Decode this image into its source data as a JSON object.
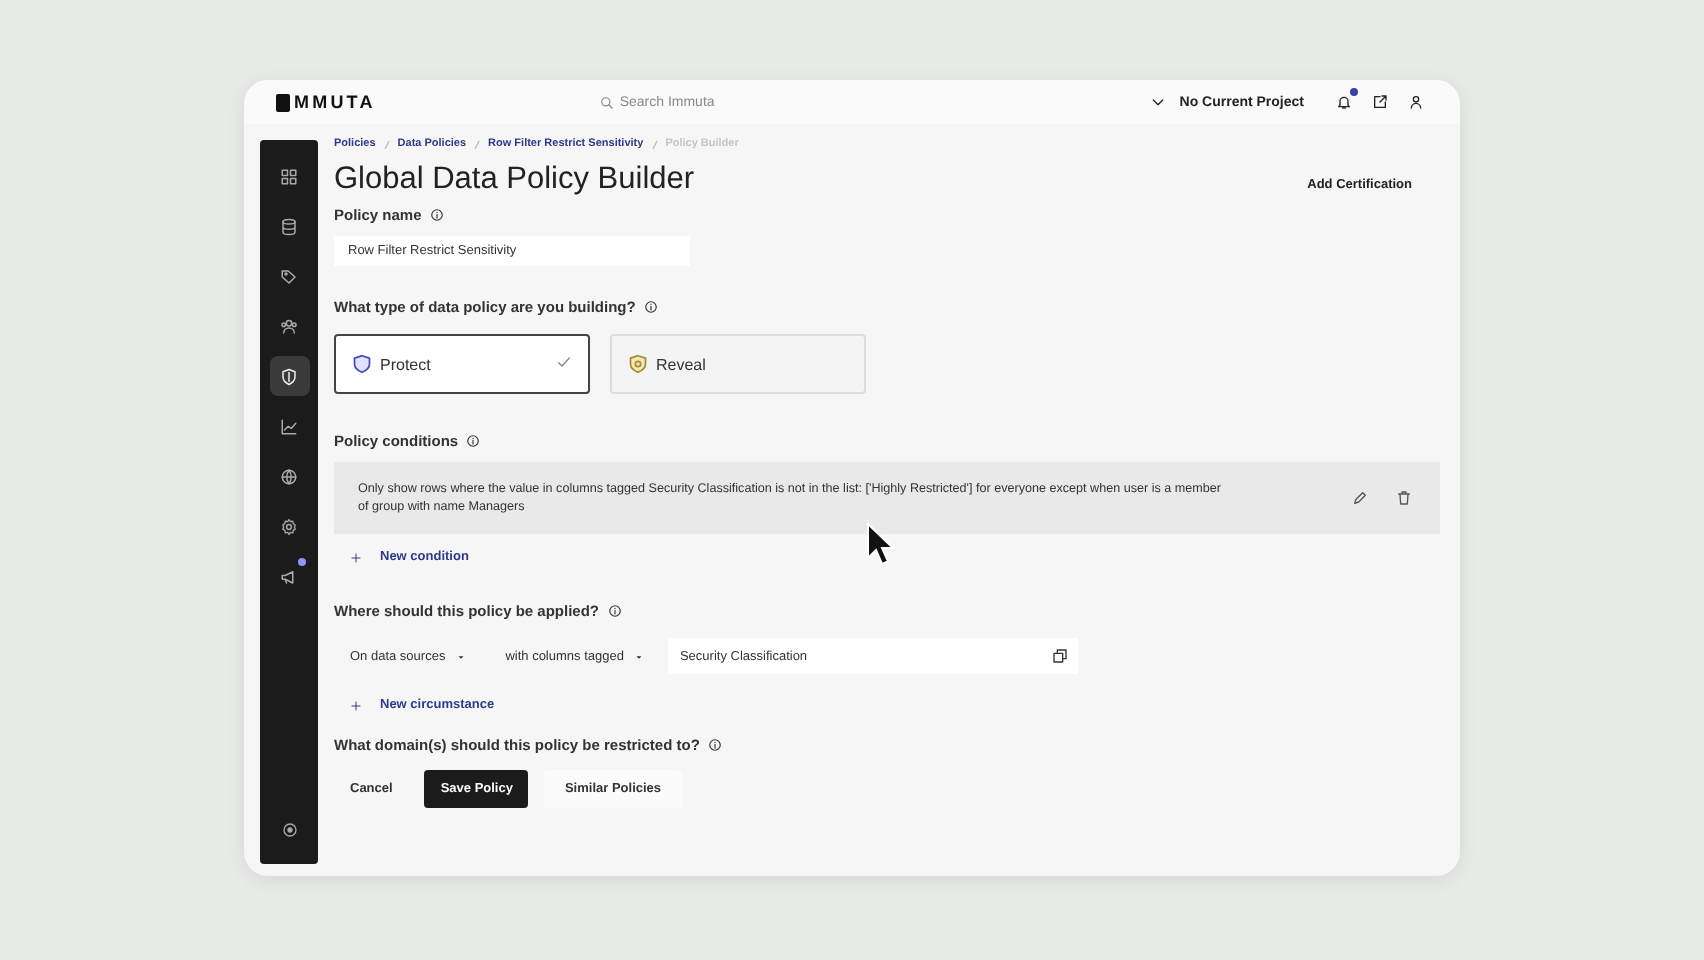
{
  "header": {
    "logo": "MMUTA",
    "search": {
      "placeholder": "Search Immuta"
    },
    "project": "No Current Project",
    "notifications_unread": true
  },
  "sidebar": {
    "items": [
      {
        "kind": "grid",
        "selected": false,
        "badge": false
      },
      {
        "kind": "database",
        "selected": false,
        "badge": false
      },
      {
        "kind": "tags",
        "selected": false,
        "badge": false
      },
      {
        "kind": "users",
        "selected": false,
        "badge": false
      },
      {
        "kind": "shield",
        "selected": true,
        "badge": false
      },
      {
        "kind": "chart",
        "selected": false,
        "badge": false
      },
      {
        "kind": "globe",
        "selected": false,
        "badge": false
      },
      {
        "kind": "gear",
        "selected": false,
        "badge": false
      },
      {
        "kind": "megaphone",
        "selected": false,
        "badge": true
      }
    ]
  },
  "breadcrumbs": [
    {
      "label": "Policies",
      "current": false
    },
    {
      "label": "Data Policies",
      "current": false
    },
    {
      "label": "Row Filter Restrict Sensitivity",
      "current": false
    },
    {
      "label": "Policy Builder",
      "current": true
    }
  ],
  "title": "Global Data Policy Builder",
  "add_certification": "Add Certification",
  "policy_name": {
    "label": "Policy name",
    "value": "Row Filter Restrict Sensitivity"
  },
  "policy_type": {
    "label": "What type of data policy are you building?",
    "options": [
      {
        "label": "Protect",
        "kind": "protect",
        "selected": true
      },
      {
        "label": "Reveal",
        "kind": "reveal",
        "selected": false
      }
    ]
  },
  "conditions": {
    "label": "Policy conditions",
    "items": [
      "Only show rows where the value in columns tagged Security Classification is not in the list: ['Highly Restricted'] for everyone except when user is a member of group with name Managers"
    ],
    "add": "New condition"
  },
  "applied": {
    "label": "Where should this policy be applied?",
    "scope": "On data sources",
    "filter": "with columns tagged",
    "value": "Security Classification",
    "add": "New circumstance"
  },
  "domains": {
    "label": "What domain(s) should this policy be restricted to?"
  },
  "buttons": [
    {
      "label": "Cancel",
      "kind": "plain"
    },
    {
      "label": "Save Policy",
      "kind": "primary"
    },
    {
      "label": "Similar Policies",
      "kind": "secondary"
    }
  ]
}
